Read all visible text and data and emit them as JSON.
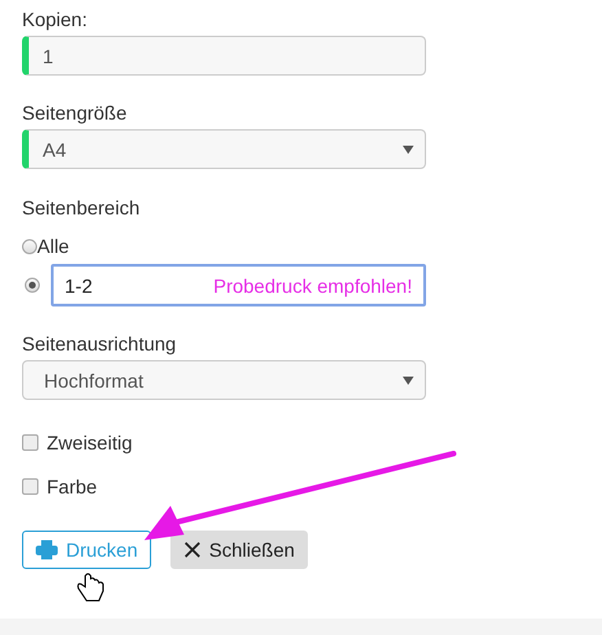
{
  "copies": {
    "label": "Kopien:",
    "value": "1",
    "valid": true
  },
  "page_size": {
    "label": "Seitengröße",
    "value": "A4",
    "valid": true
  },
  "page_range": {
    "label": "Seitenbereich",
    "options": [
      {
        "kind": "all",
        "label": "Alle",
        "selected": false
      },
      {
        "kind": "custom",
        "value": "1-2",
        "selected": true
      }
    ]
  },
  "annotation": {
    "note": "Probedruck empfohlen!"
  },
  "orientation": {
    "label": "Seitenausrichtung",
    "value": "Hochformat",
    "valid": false
  },
  "options": [
    {
      "label": "Zweiseitig",
      "checked": false
    },
    {
      "label": "Farbe",
      "checked": false
    }
  ],
  "buttons": [
    {
      "kind": "print",
      "label": "Drucken"
    },
    {
      "kind": "close",
      "label": "Schließen"
    }
  ]
}
